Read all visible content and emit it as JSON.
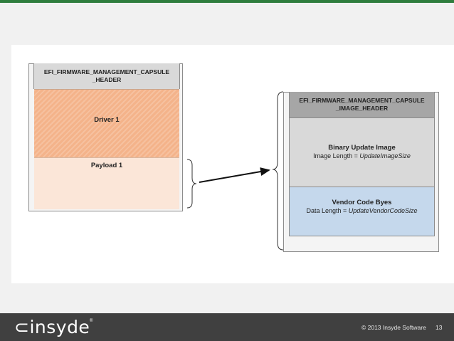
{
  "slide": {
    "left_capsule": {
      "header": "EFI_FIRMWARE_MANAGEMENT_CAPSULE\n_HEADER",
      "driver_label": "Driver 1",
      "payload_label": "Payload 1"
    },
    "right_image": {
      "header": "EFI_FIRMWARE_MANAGEMENT_CAPSULE\n_IMAGE_HEADER",
      "binary_title": "Binary Update Image",
      "binary_length_prefix": "Image Length = ",
      "binary_length_value": "UpdateImageSize",
      "vendor_title": "Vendor Code Byes",
      "vendor_length_prefix": "Data Length = ",
      "vendor_length_value": "UpdateVendorCodeSize"
    }
  },
  "footer": {
    "logo_text": "insyde",
    "registered_mark": "®",
    "copyright": "© 2013 Insyde Software",
    "page_number": "13"
  },
  "colors": {
    "accent_green": "#2f7d3e",
    "driver_fill": "#f4b38a",
    "payload_fill": "#fbe6d8",
    "vendor_fill": "#c5d8ec",
    "footer_bg": "#404040"
  }
}
